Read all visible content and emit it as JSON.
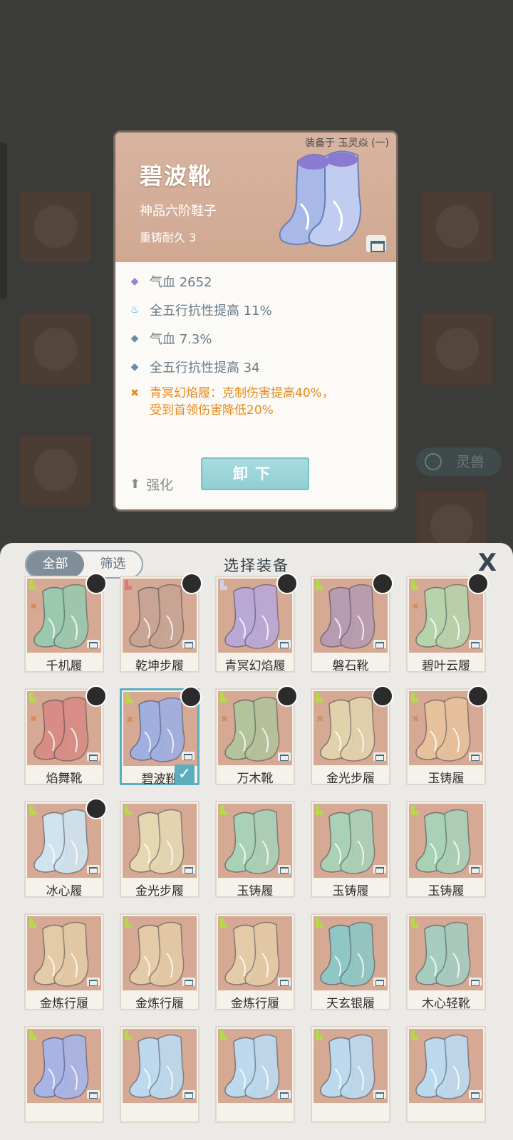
{
  "background": {
    "pet_button_label": "灵兽"
  },
  "detail": {
    "equipped_tag": "装备于 玉灵焱 (一)",
    "name": "碧波靴",
    "grade": "神品六阶鞋子",
    "recast": "重铸耐久 3",
    "stats": [
      {
        "icon": "purple-diamond-icon",
        "text": "气血 2652"
      },
      {
        "icon": "flame-shield-icon",
        "text": "全五行抗性提高 11%"
      },
      {
        "icon": "blue-diamond-icon",
        "text": "气血 7.3%"
      },
      {
        "icon": "blue-diamond-icon",
        "text": "全五行抗性提高 34"
      }
    ],
    "set_effect": {
      "line1": "青冥幻焰履：克制伤害提高40%，",
      "line2": "受到首领伤害降低20%"
    },
    "enhance_label": "强化",
    "unequip_label": "卸下"
  },
  "panel": {
    "title": "选择装备",
    "filter_all": "全部",
    "filter_sift": "筛选",
    "close_glyph": "X",
    "check_glyph": "✓",
    "items": [
      {
        "name": "千机履",
        "color": "#9bc9b0",
        "avatar": true,
        "set": true
      },
      {
        "name": "乾坤步履",
        "color": "#c7a493",
        "avatar": true,
        "set": false
      },
      {
        "name": "青冥幻焰履",
        "color": "#b9a8d6",
        "avatar": true,
        "set": false
      },
      {
        "name": "磐石靴",
        "color": "#b79bb0",
        "avatar": true,
        "set": false
      },
      {
        "name": "碧叶云履",
        "color": "#b6d3ac",
        "avatar": true,
        "set": true
      },
      {
        "name": "焰舞靴",
        "color": "#d88c86",
        "avatar": true,
        "set": true
      },
      {
        "name": "碧波靴",
        "color": "#9fb0e0",
        "avatar": true,
        "set": true,
        "selected": true
      },
      {
        "name": "万木靴",
        "color": "#b3c39c",
        "avatar": true,
        "set": true
      },
      {
        "name": "金光步履",
        "color": "#e2d2ac",
        "avatar": true,
        "set": true
      },
      {
        "name": "玉铸履",
        "color": "#e7c19c",
        "avatar": true,
        "set": true
      },
      {
        "name": "冰心履",
        "color": "#cfe4ee",
        "avatar": true,
        "set": false
      },
      {
        "name": "金光步履",
        "color": "#e6d7b3",
        "avatar": false,
        "set": false
      },
      {
        "name": "玉铸履",
        "color": "#a9d1b6",
        "avatar": false,
        "set": false
      },
      {
        "name": "玉铸履",
        "color": "#a9d1b6",
        "avatar": false,
        "set": false
      },
      {
        "name": "玉铸履",
        "color": "#a9d1b6",
        "avatar": false,
        "set": false
      },
      {
        "name": "金炼行履",
        "color": "#e4caa6",
        "avatar": false,
        "set": false
      },
      {
        "name": "金炼行履",
        "color": "#e4caa6",
        "avatar": false,
        "set": false
      },
      {
        "name": "金炼行履",
        "color": "#e4caa6",
        "avatar": false,
        "set": false
      },
      {
        "name": "天玄银履",
        "color": "#8fc7c4",
        "avatar": false,
        "set": false
      },
      {
        "name": "木心轻靴",
        "color": "#a6ccc0",
        "avatar": false,
        "set": false
      },
      {
        "name": "",
        "color": "#a8b4e6",
        "avatar": false,
        "set": false
      },
      {
        "name": "",
        "color": "#bcd9ee",
        "avatar": false,
        "set": false
      },
      {
        "name": "",
        "color": "#bcd9ee",
        "avatar": false,
        "set": false
      },
      {
        "name": "",
        "color": "#bcd9ee",
        "avatar": false,
        "set": false
      },
      {
        "name": "",
        "color": "#bcd9ee",
        "avatar": false,
        "set": false
      }
    ]
  }
}
